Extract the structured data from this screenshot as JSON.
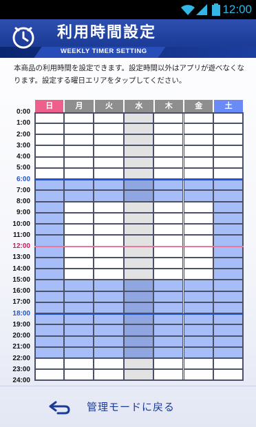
{
  "status_bar": {
    "time": "12:00",
    "icons": [
      "wifi-icon",
      "signal-icon",
      "battery-icon"
    ],
    "accent_color": "#33b5e5"
  },
  "header": {
    "icon": "clock-icon",
    "title": "利用時間設定",
    "subtitle": "WEEKLY TIMER SETTING"
  },
  "description": "本商品の利用時間を設定できます。設定時間以外はアプリが遊べなくなります。設定する曜日エリアをタップしてください。",
  "days": [
    {
      "label": "日",
      "color": "#ee5f8c",
      "selected": true
    },
    {
      "label": "月",
      "color": "#8e8e8e",
      "selected": false
    },
    {
      "label": "火",
      "color": "#8e8e8e",
      "selected": false
    },
    {
      "label": "水",
      "color": "#8e8e8e",
      "selected": false
    },
    {
      "label": "木",
      "color": "#8e8e8e",
      "selected": false
    },
    {
      "label": "金",
      "color": "#8e8e8e",
      "selected": false
    },
    {
      "label": "土",
      "color": "#6a8bf5",
      "selected": false
    }
  ],
  "hours": [
    "0:00",
    "1:00",
    "2:00",
    "3:00",
    "4:00",
    "5:00",
    "6:00",
    "7:00",
    "8:00",
    "9:00",
    "10:00",
    "11:00",
    "12:00",
    "13:00",
    "14:00",
    "15:00",
    "16:00",
    "17:00",
    "18:00",
    "19:00",
    "20:00",
    "21:00",
    "22:00",
    "23:00",
    "24:00"
  ],
  "highlight_hours": {
    "6:00": "blue",
    "12:00": "pink",
    "18:00": "blue"
  },
  "colors": {
    "enabled": "#a7bdf7",
    "disabled": "#ffffff",
    "selected_column_enabled": "#8fa6e0",
    "selected_column_disabled": "#e2e2e2",
    "grid_line": "#4a5068",
    "blue_marker": "#1e55d6",
    "pink_marker": "#f0759d"
  },
  "schedule_enabled": {
    "日": [
      6,
      7,
      8,
      9,
      10,
      11,
      12,
      13,
      14,
      15,
      16,
      17,
      18,
      19,
      20,
      21
    ],
    "月": [
      6,
      7,
      15,
      16,
      17,
      18,
      19,
      20,
      21
    ],
    "火": [
      6,
      7,
      15,
      16,
      17,
      18,
      19,
      20,
      21
    ],
    "水": [
      6,
      7,
      15,
      16,
      17,
      18,
      19,
      20,
      21
    ],
    "木": [
      6,
      7,
      15,
      16,
      17,
      18,
      19,
      20,
      21
    ],
    "金": [
      6,
      7,
      15,
      16,
      17,
      18,
      19,
      20,
      21
    ],
    "土": [
      6,
      7,
      8,
      9,
      10,
      11,
      12,
      13,
      14,
      15,
      16,
      17,
      18,
      19,
      20,
      21
    ]
  },
  "footer": {
    "icon": "back-arrow-icon",
    "back_label": "管理モードに戻る"
  }
}
